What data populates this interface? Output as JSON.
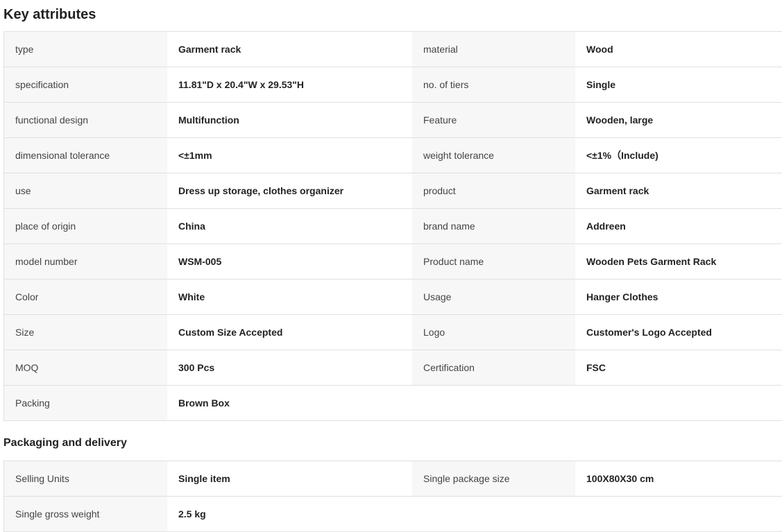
{
  "sections": {
    "key_attributes": {
      "title": "Key attributes",
      "rows": [
        [
          {
            "k": "type",
            "v": "Garment rack"
          },
          {
            "k": "material",
            "v": "Wood"
          }
        ],
        [
          {
            "k": "specification",
            "v": "11.81\"D x 20.4\"W x 29.53\"H"
          },
          {
            "k": "no. of tiers",
            "v": "Single"
          }
        ],
        [
          {
            "k": "functional design",
            "v": "Multifunction"
          },
          {
            "k": "Feature",
            "v": "Wooden, large"
          }
        ],
        [
          {
            "k": "dimensional tolerance",
            "v": "<±1mm"
          },
          {
            "k": "weight tolerance",
            "v": "<±1%（Include)"
          }
        ],
        [
          {
            "k": "use",
            "v": "Dress up storage, clothes organizer"
          },
          {
            "k": "product",
            "v": "Garment rack"
          }
        ],
        [
          {
            "k": "place of origin",
            "v": "China"
          },
          {
            "k": "brand name",
            "v": "Addreen"
          }
        ],
        [
          {
            "k": "model number",
            "v": "WSM-005"
          },
          {
            "k": "Product name",
            "v": "Wooden Pets Garment Rack"
          }
        ],
        [
          {
            "k": "Color",
            "v": "White"
          },
          {
            "k": "Usage",
            "v": "Hanger Clothes"
          }
        ],
        [
          {
            "k": "Size",
            "v": "Custom Size Accepted"
          },
          {
            "k": "Logo",
            "v": "Customer's Logo Accepted"
          }
        ],
        [
          {
            "k": "MOQ",
            "v": "300 Pcs"
          },
          {
            "k": "Certification",
            "v": "FSC"
          }
        ],
        [
          {
            "k": "Packing",
            "v": "Brown Box"
          }
        ]
      ]
    },
    "packaging_delivery": {
      "title": "Packaging and delivery",
      "rows": [
        [
          {
            "k": "Selling Units",
            "v": "Single item"
          },
          {
            "k": "Single package size",
            "v": "100X80X30 cm"
          }
        ],
        [
          {
            "k": "Single gross weight",
            "v": "2.5 kg"
          }
        ]
      ]
    }
  }
}
